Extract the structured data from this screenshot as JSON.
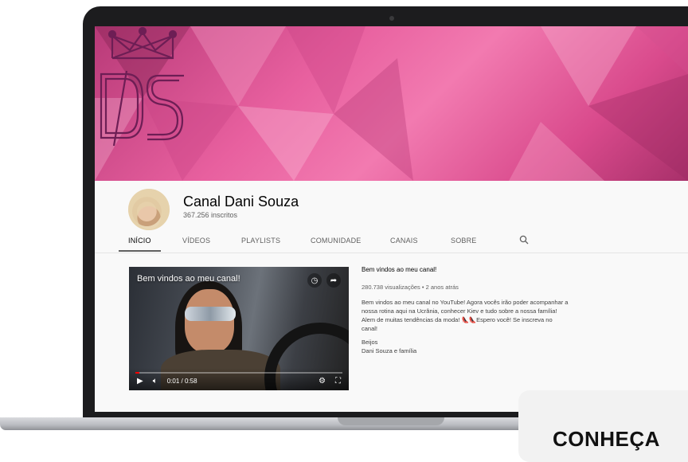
{
  "channel": {
    "name": "Canal Dani Souza",
    "subscribers": "367.256 inscritos"
  },
  "tabs": [
    {
      "label": "INÍCIO"
    },
    {
      "label": "VÍDEOS"
    },
    {
      "label": "PLAYLISTS"
    },
    {
      "label": "COMUNIDADE"
    },
    {
      "label": "CANAIS"
    },
    {
      "label": "SOBRE"
    }
  ],
  "banner": {
    "logo_text": "DS"
  },
  "video": {
    "overlay_title": "Bem vindos ao meu canal!",
    "time": "0:01 / 0:58",
    "progress": 0.02
  },
  "description": {
    "title": "Bem vindos ao meu canal!",
    "meta": "280.738 visualizações • 2 anos atrás",
    "body": "Bem vindos ao meu canal no YouTube! Agora vocês irão poder acompanhar a nossa rotina aqui na Ucrânia, conhecer Kiev e tudo sobre a nossa família! Alem de muitas tendências da moda! 👠👠Espero você! Se inscreva no canal!",
    "sign_1": "Beijos",
    "sign_2": "Dani Souza e família"
  },
  "promo": {
    "text": "CONHEÇA"
  },
  "colors": {
    "accent": "#e8609f",
    "progress": "#ff0000"
  }
}
